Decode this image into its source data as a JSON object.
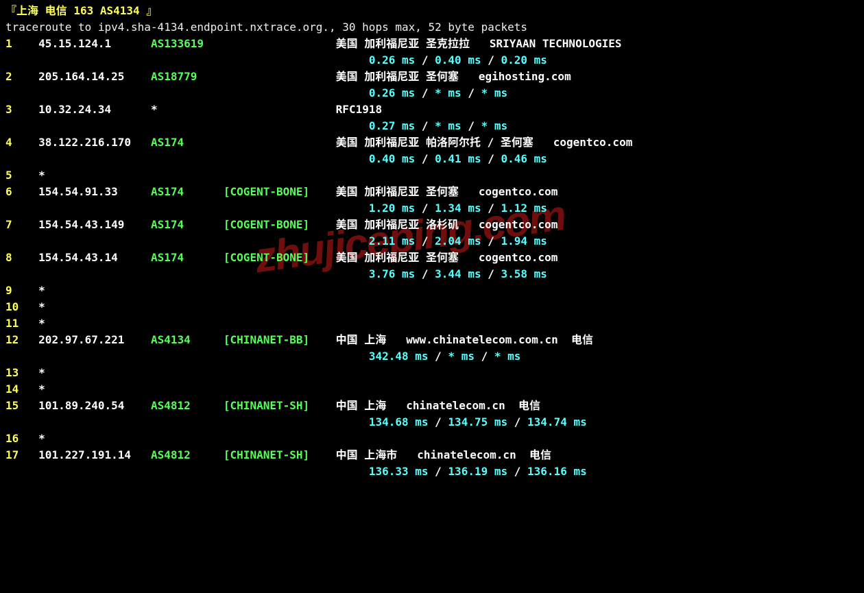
{
  "header": {
    "bracket_open": "『",
    "city": "上海",
    "space1": " ",
    "carrier": "电信",
    "space2": " ",
    "net_code": "163",
    "space3": " ",
    "asn_title": "AS4134",
    "space4": " ",
    "bracket_close": "』"
  },
  "cmdline": "traceroute to ipv4.sha-4134.endpoint.nxtrace.org., 30 hops max, 52 byte packets",
  "watermark": "zhujiceping.com",
  "hop_col_width": 5,
  "ip_col_width": 17,
  "asn_col_width": 11,
  "tag_col_width": 17,
  "latency_indent": 55,
  "hops": [
    {
      "n": "1",
      "ip": "45.15.124.1",
      "asn": "AS133619",
      "tag": "",
      "loc": "美国 加利福尼亚 圣克拉拉   SRIYAAN TECHNOLOGIES",
      "lat": [
        "0.26 ms",
        "0.40 ms",
        "0.20 ms"
      ]
    },
    {
      "n": "2",
      "ip": "205.164.14.25",
      "asn": "AS18779",
      "tag": "",
      "loc": "美国 加利福尼亚 圣何塞   egihosting.com",
      "lat": [
        "0.26 ms",
        "* ms",
        "* ms"
      ]
    },
    {
      "n": "3",
      "ip": "10.32.24.34",
      "asn": "*",
      "asn_white": true,
      "tag": "",
      "loc": "RFC1918",
      "lat": [
        "0.27 ms",
        "* ms",
        "* ms"
      ]
    },
    {
      "n": "4",
      "ip": "38.122.216.170",
      "asn": "AS174",
      "tag": "",
      "loc": "美国 加利福尼亚 帕洛阿尔托 / 圣何塞   cogentco.com",
      "lat": [
        "0.40 ms",
        "0.41 ms",
        "0.46 ms"
      ]
    },
    {
      "n": "5",
      "ip": "*",
      "timeout": true
    },
    {
      "n": "6",
      "ip": "154.54.91.33",
      "asn": "AS174",
      "tag": "[COGENT-BONE]",
      "loc": "美国 加利福尼亚 圣何塞   cogentco.com",
      "lat": [
        "1.20 ms",
        "1.34 ms",
        "1.12 ms"
      ]
    },
    {
      "n": "7",
      "ip": "154.54.43.149",
      "asn": "AS174",
      "tag": "[COGENT-BONE]",
      "loc": "美国 加利福尼亚 洛杉矶   cogentco.com",
      "lat": [
        "2.11 ms",
        "2.04 ms",
        "1.94 ms"
      ]
    },
    {
      "n": "8",
      "ip": "154.54.43.14",
      "asn": "AS174",
      "tag": "[COGENT-BONE]",
      "loc": "美国 加利福尼亚 圣何塞   cogentco.com",
      "lat": [
        "3.76 ms",
        "3.44 ms",
        "3.58 ms"
      ]
    },
    {
      "n": "9",
      "ip": "*",
      "timeout": true
    },
    {
      "n": "10",
      "ip": "*",
      "timeout": true
    },
    {
      "n": "11",
      "ip": "*",
      "timeout": true
    },
    {
      "n": "12",
      "ip": "202.97.67.221",
      "asn": "AS4134",
      "tag": "[CHINANET-BB]",
      "loc": "中国 上海   www.chinatelecom.com.cn  电信",
      "lat": [
        "342.48 ms",
        "* ms",
        "* ms"
      ]
    },
    {
      "n": "13",
      "ip": "*",
      "timeout": true
    },
    {
      "n": "14",
      "ip": "*",
      "timeout": true
    },
    {
      "n": "15",
      "ip": "101.89.240.54",
      "asn": "AS4812",
      "tag": "[CHINANET-SH]",
      "loc": "中国 上海   chinatelecom.cn  电信",
      "lat": [
        "134.68 ms",
        "134.75 ms",
        "134.74 ms"
      ]
    },
    {
      "n": "16",
      "ip": "*",
      "timeout": true
    },
    {
      "n": "17",
      "ip": "101.227.191.14",
      "asn": "AS4812",
      "tag": "[CHINANET-SH]",
      "loc": "中国 上海市   chinatelecom.cn  电信",
      "lat": [
        "136.33 ms",
        "136.19 ms",
        "136.16 ms"
      ]
    }
  ]
}
